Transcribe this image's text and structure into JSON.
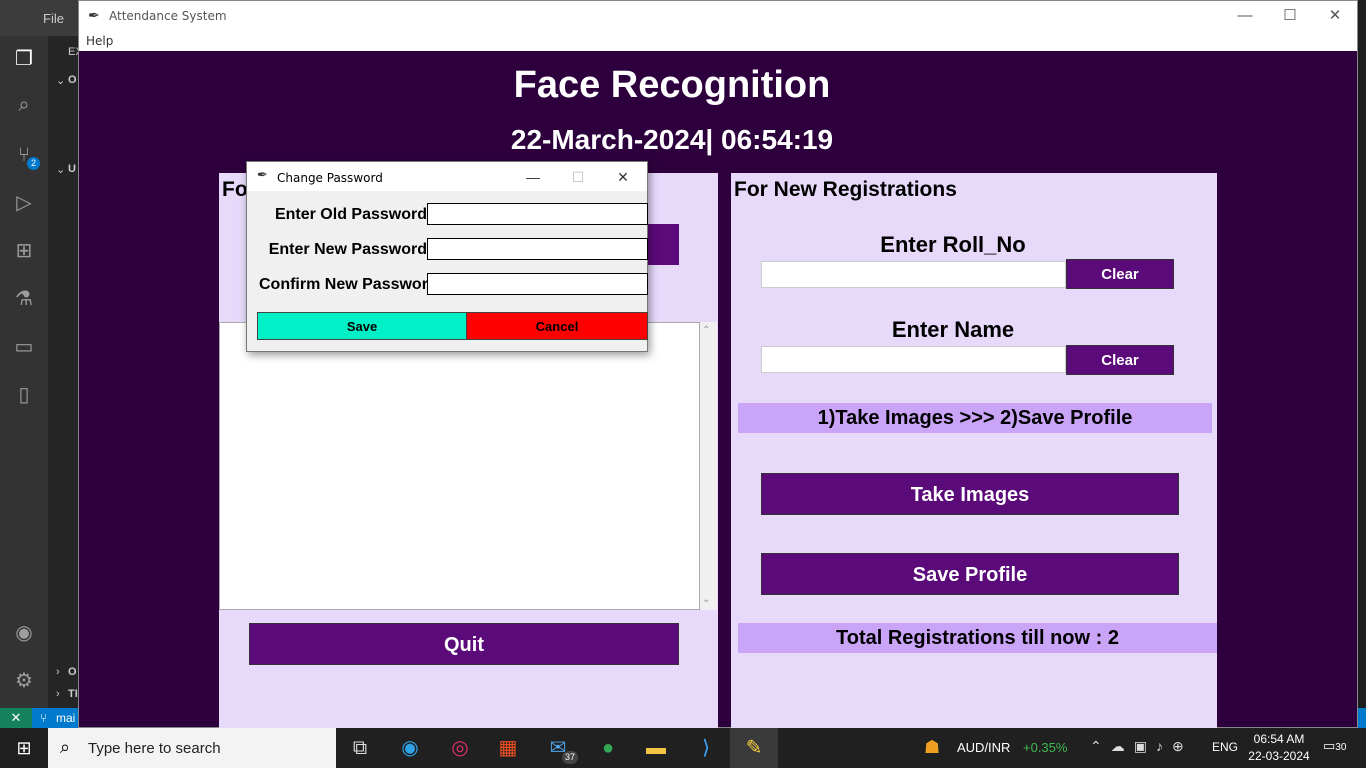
{
  "vscode": {
    "menu_file": "File",
    "side_fragments": [
      "EX",
      "O",
      "U",
      "O",
      "TI"
    ],
    "source_control_badge": "2",
    "branch": "mai"
  },
  "app": {
    "window_title": "Attendance System",
    "menu_help": "Help",
    "heading": "Face Recognition",
    "datetime": "22-March-2024| 06:54:19",
    "left_heading_fragment": "Fo",
    "quit_label": "Quit",
    "right_heading": "For New Registrations",
    "roll_label": "Enter Roll_No",
    "name_label": "Enter Name",
    "clear_label": "Clear",
    "steps_text": "1)Take Images  >>>  2)Save Profile",
    "take_images_label": "Take Images",
    "save_profile_label": "Save Profile",
    "total_registrations": "Total Registrations till now  : 2",
    "colors": {
      "background": "#2d003d",
      "panel": "#e6d9fa",
      "button": "#5b0a7a",
      "info_bar": "#c9a4f7"
    }
  },
  "dialog": {
    "title": "Change Password",
    "old_password_label": "Enter Old Password",
    "new_password_label": "Enter New Password",
    "confirm_password_label": "Confirm New Password",
    "save_label": "Save",
    "cancel_label": "Cancel",
    "colors": {
      "save": "#00f0c8",
      "cancel": "#ff0000"
    }
  },
  "taskbar": {
    "search_placeholder": "Type here to search",
    "mail_badge": "37",
    "ticker_pair": "AUD/INR",
    "ticker_change": "+0.35%",
    "language": "ENG",
    "time": "06:54 AM",
    "date": "22-03-2024",
    "notification_count": "30"
  }
}
